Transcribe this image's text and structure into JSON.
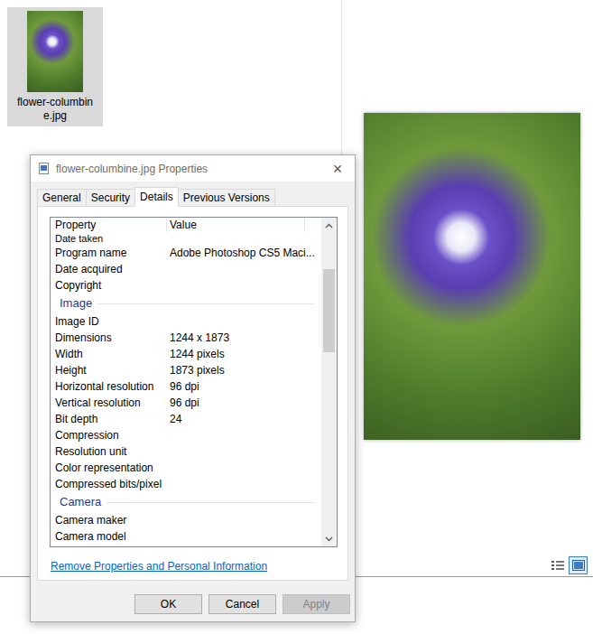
{
  "explorer": {
    "file": {
      "label_lines": [
        "flower-columbin",
        "e.jpg"
      ],
      "selected": true
    },
    "view_buttons": [
      {
        "kind": "details",
        "selected": false
      },
      {
        "kind": "large-icons",
        "selected": true
      }
    ]
  },
  "dialog": {
    "title": "flower-columbine.jpg Properties",
    "close": "×",
    "tabs": [
      {
        "label": "General",
        "selected": false
      },
      {
        "label": "Security",
        "selected": false
      },
      {
        "label": "Details",
        "selected": true
      },
      {
        "label": "Previous Versions",
        "selected": false
      }
    ],
    "columns": [
      "Property",
      "Value"
    ],
    "rows": [
      {
        "kind": "property",
        "name": "Date taken",
        "value": "",
        "partial": true
      },
      {
        "kind": "property",
        "name": "Program name",
        "value": "Adobe Photoshop CS5 Maci...",
        "partial": false
      },
      {
        "kind": "property",
        "name": "Date acquired",
        "value": "",
        "partial": false
      },
      {
        "kind": "property",
        "name": "Copyright",
        "value": "",
        "partial": false
      },
      {
        "kind": "section",
        "name": "Image"
      },
      {
        "kind": "property",
        "name": "Image ID",
        "value": "",
        "partial": false
      },
      {
        "kind": "property",
        "name": "Dimensions",
        "value": "1244 x 1873",
        "partial": false
      },
      {
        "kind": "property",
        "name": "Width",
        "value": "1244 pixels",
        "partial": false
      },
      {
        "kind": "property",
        "name": "Height",
        "value": "1873 pixels",
        "partial": false
      },
      {
        "kind": "property",
        "name": "Horizontal resolution",
        "value": "96 dpi",
        "partial": false
      },
      {
        "kind": "property",
        "name": "Vertical resolution",
        "value": "96 dpi",
        "partial": false
      },
      {
        "kind": "property",
        "name": "Bit depth",
        "value": "24",
        "partial": false
      },
      {
        "kind": "property",
        "name": "Compression",
        "value": "",
        "partial": false
      },
      {
        "kind": "property",
        "name": "Resolution unit",
        "value": "",
        "partial": false
      },
      {
        "kind": "property",
        "name": "Color representation",
        "value": "",
        "partial": false
      },
      {
        "kind": "property",
        "name": "Compressed bits/pixel",
        "value": "",
        "partial": false
      },
      {
        "kind": "section",
        "name": "Camera"
      },
      {
        "kind": "property",
        "name": "Camera maker",
        "value": "",
        "partial": false
      },
      {
        "kind": "property",
        "name": "Camera model",
        "value": "",
        "partial": false
      }
    ],
    "scrollbar": {
      "offset": 0.12,
      "level": 0.28
    },
    "link": "Remove Properties and Personal Information",
    "buttons": [
      {
        "label": "OK",
        "disabled": false
      },
      {
        "label": "Cancel",
        "disabled": false
      },
      {
        "label": "Apply",
        "disabled": true
      }
    ]
  }
}
